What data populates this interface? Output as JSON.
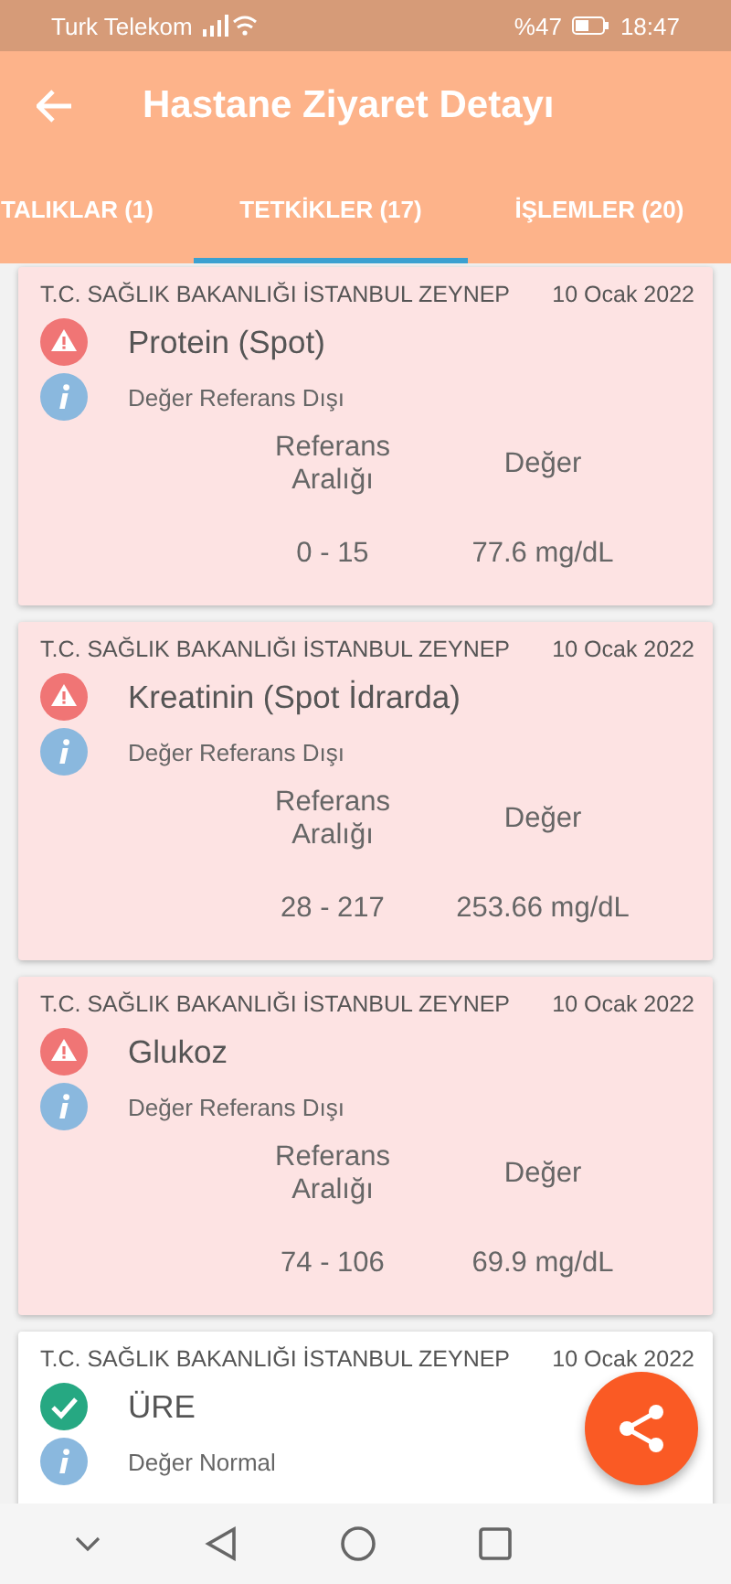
{
  "status_bar": {
    "carrier": "Turk Telekom",
    "battery": "%47",
    "time": "18:47"
  },
  "app_bar": {
    "title": "Hastane Ziyaret Detayı"
  },
  "tabs": [
    {
      "label": "TALIKLAR (1)",
      "selected": false
    },
    {
      "label": "TETKİKLER (17)",
      "selected": true
    },
    {
      "label": "İŞLEMLER (20)",
      "selected": false
    }
  ],
  "results": [
    {
      "kind": "alert",
      "hospital": "T.C. SAĞLIK BAKANLIĞI İSTANBUL ZEYNEP",
      "date": "10 Ocak 2022",
      "test": "Protein (Spot)",
      "status": "Değer Referans Dışı",
      "ref_label": "Referans Aralığı",
      "value_label": "Değer",
      "ref": "0 - 15",
      "value": "77.6 mg/dL"
    },
    {
      "kind": "alert",
      "hospital": "T.C. SAĞLIK BAKANLIĞI İSTANBUL ZEYNEP",
      "date": "10 Ocak 2022",
      "test": "Kreatinin (Spot İdrarda)",
      "status": "Değer Referans Dışı",
      "ref_label": "Referans Aralığı",
      "value_label": "Değer",
      "ref": "28 - 217",
      "value": "253.66 mg/dL"
    },
    {
      "kind": "alert",
      "hospital": "T.C. SAĞLIK BAKANLIĞI İSTANBUL ZEYNEP",
      "date": "10 Ocak 2022",
      "test": "Glukoz",
      "status": "Değer Referans Dışı",
      "ref_label": "Referans Aralığı",
      "value_label": "Değer",
      "ref": "74 - 106",
      "value": "69.9 mg/dL"
    },
    {
      "kind": "normal",
      "hospital": "T.C. SAĞLIK BAKANLIĞI İSTANBUL ZEYNEP",
      "date": "10 Ocak 2022",
      "test": "ÜRE",
      "status": "Değer Normal"
    }
  ]
}
